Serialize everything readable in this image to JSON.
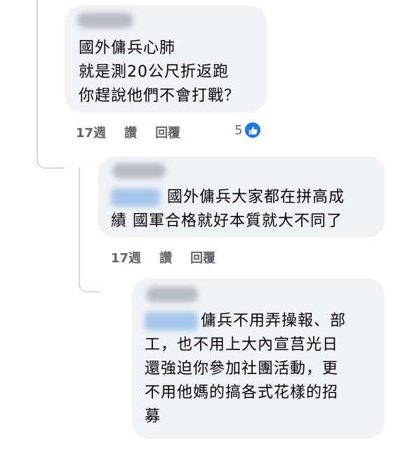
{
  "comments": [
    {
      "lines": [
        "國外傭兵心肺",
        "就是測20公尺折返跑",
        "你趕說他們不會打戰？"
      ],
      "time": "17週",
      "like": "讚",
      "reply": "回覆",
      "reaction_count": "5",
      "reaction_icon": "like-icon"
    },
    {
      "lines": [
        "國外傭兵大家都在拼高成",
        "績 國軍合格就好本質就大不同了"
      ],
      "time": "17週",
      "like": "讚",
      "reply": "回覆"
    },
    {
      "lines": [
        "傭兵不用弄操報、部",
        "工，也不用上大內宣莒光日",
        "還強迫你參加社團活動，更",
        "不用他媽的搞各式花樣的招",
        "募"
      ]
    }
  ],
  "colors": {
    "bubble": "#f0f2f5",
    "like_blue": "#1877f2",
    "meta_gray": "#65676b"
  }
}
